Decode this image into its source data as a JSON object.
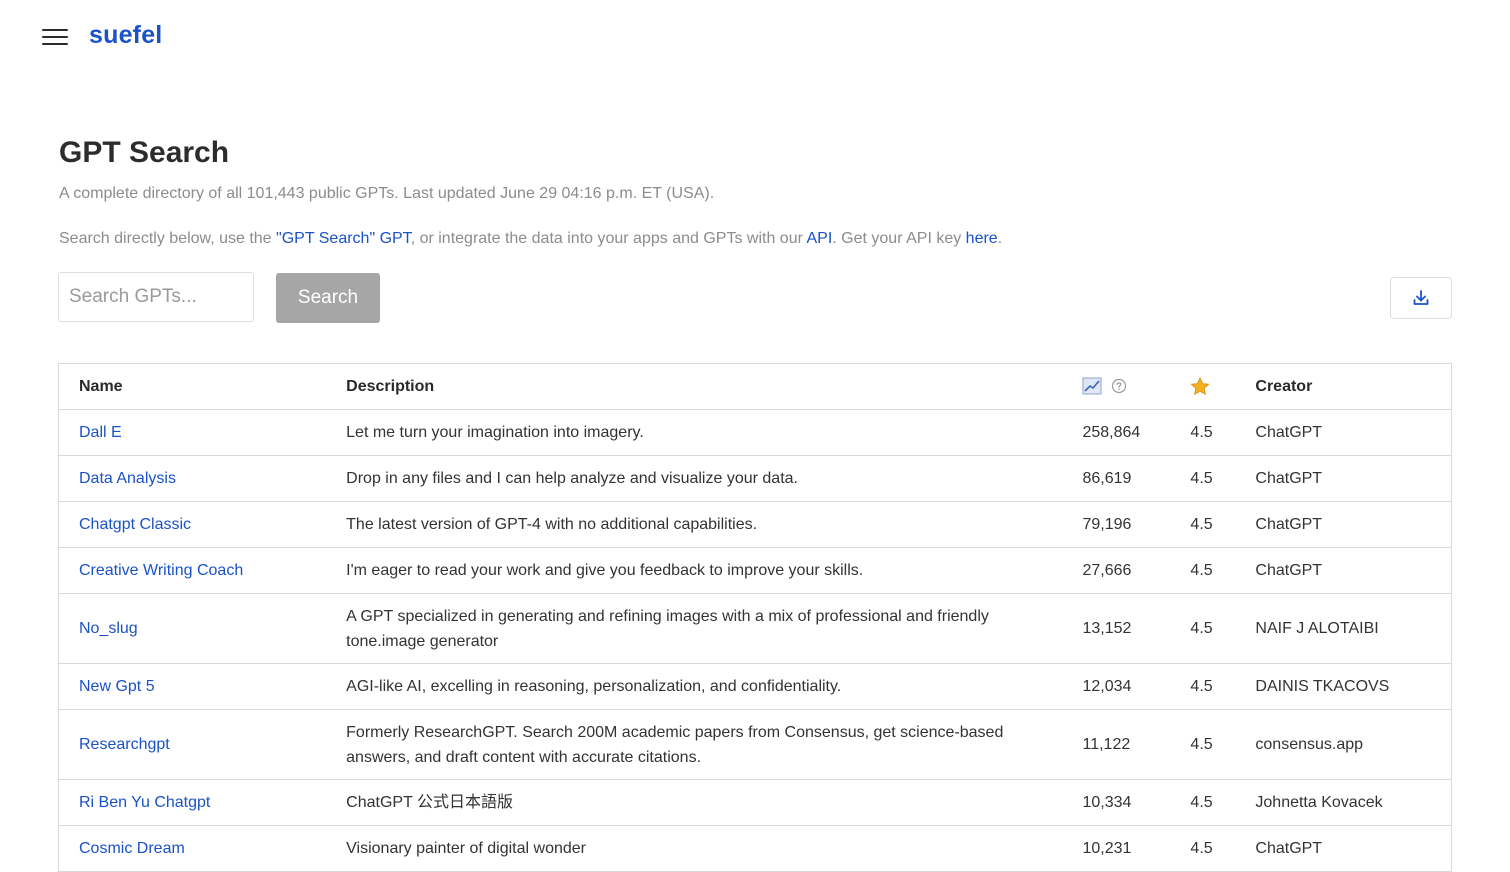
{
  "header": {
    "brand": "suefel"
  },
  "page": {
    "title": "GPT Search",
    "subtitle": "A complete directory of all 101,443 public GPTs. Last updated June 29 04:16 p.m. ET (USA).",
    "intro": {
      "before_link1": "Search directly below, use the ",
      "link1": "\"GPT Search\" GPT",
      "between1": ", or integrate the data into your apps and GPTs with our ",
      "link2": "API",
      "between2": ". Get your API key ",
      "link3": "here",
      "after": "."
    }
  },
  "search": {
    "placeholder": "Search GPTs...",
    "value": "",
    "button_label": "Search"
  },
  "icons": {
    "menu": "hamburger-menu-icon",
    "download": "download-icon",
    "uses": "trend-chart-icon",
    "help": "question-circle-icon",
    "rating": "star-icon"
  },
  "colors": {
    "brand": "#1a52c8",
    "search_button": "#a6a6a6",
    "star": "#f2b01e"
  },
  "table": {
    "headers": {
      "name": "Name",
      "description": "Description",
      "creator": "Creator"
    },
    "rows": [
      {
        "name": "Dall E",
        "description": "Let me turn your imagination into imagery.",
        "uses": "258,864",
        "rating": "4.5",
        "creator": "ChatGPT"
      },
      {
        "name": "Data Analysis",
        "description": "Drop in any files and I can help analyze and visualize your data.",
        "uses": "86,619",
        "rating": "4.5",
        "creator": "ChatGPT"
      },
      {
        "name": "Chatgpt Classic",
        "description": "The latest version of GPT-4 with no additional capabilities.",
        "uses": "79,196",
        "rating": "4.5",
        "creator": "ChatGPT"
      },
      {
        "name": "Creative Writing Coach",
        "description": "I'm eager to read your work and give you feedback to improve your skills.",
        "uses": "27,666",
        "rating": "4.5",
        "creator": "ChatGPT"
      },
      {
        "name": "No_slug",
        "description": "A GPT specialized in generating and refining images with a mix of professional and friendly tone.image generator",
        "uses": "13,152",
        "rating": "4.5",
        "creator": "NAIF J ALOTAIBI"
      },
      {
        "name": "New Gpt 5",
        "description": "AGI-like AI, excelling in reasoning, personalization, and confidentiality.",
        "uses": "12,034",
        "rating": "4.5",
        "creator": "DAINIS TKACOVS"
      },
      {
        "name": "Researchgpt",
        "description": "Formerly ResearchGPT. Search 200M academic papers from Consensus, get science-based answers, and draft content with accurate citations.",
        "uses": "11,122",
        "rating": "4.5",
        "creator": "consensus.app"
      },
      {
        "name": "Ri Ben Yu Chatgpt",
        "description": "ChatGPT 公式日本語版",
        "uses": "10,334",
        "rating": "4.5",
        "creator": "Johnetta Kovacek"
      },
      {
        "name": "Cosmic Dream",
        "description": "Visionary painter of digital wonder",
        "uses": "10,231",
        "rating": "4.5",
        "creator": "ChatGPT"
      }
    ]
  }
}
